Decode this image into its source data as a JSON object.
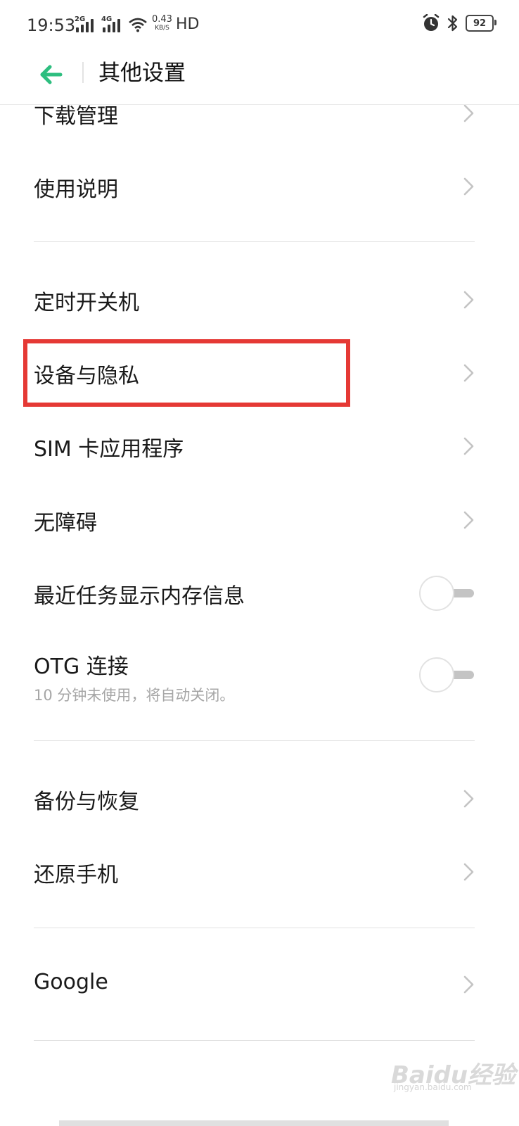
{
  "status_bar": {
    "time": "19:53",
    "sim1_tag": "2G",
    "sim2_tag": "4G",
    "net_speed": "0.43",
    "net_unit": "KB/S",
    "hd": "HD",
    "battery": "92",
    "icons": [
      "alarm-icon",
      "bluetooth-icon",
      "battery-icon",
      "wifi-icon",
      "signal-icon"
    ]
  },
  "header": {
    "title": "其他设置",
    "back_icon": "arrow-left-icon",
    "accent": "#2dbe7f"
  },
  "items": [
    {
      "label": "下载管理",
      "type": "chevron"
    },
    {
      "label": "使用说明",
      "type": "chevron"
    },
    {
      "label": "定时开关机",
      "type": "chevron"
    },
    {
      "label": "设备与隐私",
      "type": "chevron",
      "highlighted": true
    },
    {
      "label": "SIM 卡应用程序",
      "type": "chevron"
    },
    {
      "label": "无障碍",
      "type": "chevron"
    },
    {
      "label": "最近任务显示内存信息",
      "type": "toggle",
      "value": false
    },
    {
      "label": "OTG 连接",
      "subtitle": "10 分钟未使用，将自动关闭。",
      "type": "toggle",
      "value": false
    },
    {
      "label": "备份与恢复",
      "type": "chevron"
    },
    {
      "label": "还原手机",
      "type": "chevron"
    },
    {
      "label": "Google",
      "type": "chevron"
    }
  ],
  "highlight_color": "#e53935",
  "watermark": {
    "text": "Baidu经验",
    "sub": "jingyan.baidu.com"
  }
}
